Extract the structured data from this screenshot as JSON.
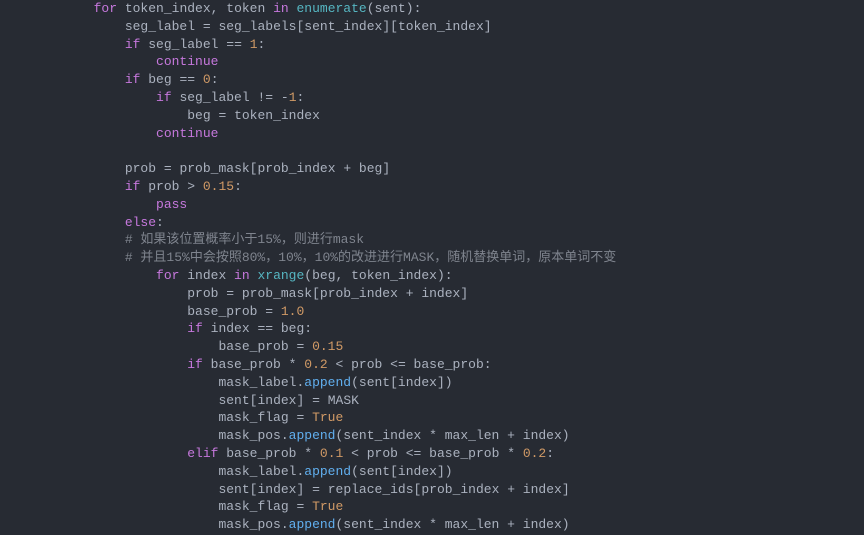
{
  "code": {
    "lines": [
      {
        "indent": 12,
        "parts": [
          [
            "kw",
            "for"
          ],
          [
            "",
            " token_index"
          ],
          [
            "op",
            ","
          ],
          [
            "",
            " token "
          ],
          [
            "kw",
            "in"
          ],
          [
            "",
            " "
          ],
          [
            "fn",
            "enumerate"
          ],
          [
            "op",
            "("
          ],
          [
            "",
            "sent"
          ],
          [
            "op",
            ")"
          ],
          [
            "op",
            ":"
          ]
        ]
      },
      {
        "indent": 16,
        "parts": [
          [
            "",
            "seg_label "
          ],
          [
            "op",
            "="
          ],
          [
            "",
            " seg_labels"
          ],
          [
            "op",
            "["
          ],
          [
            "",
            "sent_index"
          ],
          [
            "op",
            "]"
          ],
          [
            "op",
            "["
          ],
          [
            "",
            "token_index"
          ],
          [
            "op",
            "]"
          ]
        ]
      },
      {
        "indent": 16,
        "parts": [
          [
            "kw",
            "if"
          ],
          [
            "",
            " seg_label "
          ],
          [
            "op",
            "=="
          ],
          [
            "",
            " "
          ],
          [
            "num",
            "1"
          ],
          [
            "op",
            ":"
          ]
        ]
      },
      {
        "indent": 20,
        "parts": [
          [
            "kw",
            "continue"
          ]
        ]
      },
      {
        "indent": 16,
        "parts": [
          [
            "kw",
            "if"
          ],
          [
            "",
            " beg "
          ],
          [
            "op",
            "=="
          ],
          [
            "",
            " "
          ],
          [
            "num",
            "0"
          ],
          [
            "op",
            ":"
          ]
        ]
      },
      {
        "indent": 20,
        "parts": [
          [
            "kw",
            "if"
          ],
          [
            "",
            " seg_label "
          ],
          [
            "op",
            "!="
          ],
          [
            "",
            " "
          ],
          [
            "op",
            "-"
          ],
          [
            "num",
            "1"
          ],
          [
            "op",
            ":"
          ]
        ]
      },
      {
        "indent": 24,
        "parts": [
          [
            "",
            "beg "
          ],
          [
            "op",
            "="
          ],
          [
            "",
            " token_index"
          ]
        ]
      },
      {
        "indent": 20,
        "parts": [
          [
            "kw",
            "continue"
          ]
        ]
      },
      {
        "indent": 0,
        "parts": [
          [
            "",
            ""
          ]
        ]
      },
      {
        "indent": 16,
        "parts": [
          [
            "",
            "prob "
          ],
          [
            "op",
            "="
          ],
          [
            "",
            " prob_mask"
          ],
          [
            "op",
            "["
          ],
          [
            "",
            "prob_index "
          ],
          [
            "op",
            "+"
          ],
          [
            "",
            " beg"
          ],
          [
            "op",
            "]"
          ]
        ]
      },
      {
        "indent": 16,
        "parts": [
          [
            "kw",
            "if"
          ],
          [
            "",
            " prob "
          ],
          [
            "op",
            ">"
          ],
          [
            "",
            " "
          ],
          [
            "num",
            "0.15"
          ],
          [
            "op",
            ":"
          ]
        ]
      },
      {
        "indent": 20,
        "parts": [
          [
            "kw",
            "pass"
          ]
        ]
      },
      {
        "indent": 16,
        "parts": [
          [
            "kw",
            "else"
          ],
          [
            "op",
            ":"
          ]
        ]
      },
      {
        "indent": 16,
        "parts": [
          [
            "cmt",
            "# 如果该位置概率小于15%，则进行mask"
          ]
        ]
      },
      {
        "indent": 16,
        "parts": [
          [
            "cmt",
            "# 并且15%中会按照80%，10%，10%的改进进行MASK，随机替换单词，原本单词不变"
          ]
        ]
      },
      {
        "indent": 20,
        "parts": [
          [
            "kw",
            "for"
          ],
          [
            "",
            " index "
          ],
          [
            "kw",
            "in"
          ],
          [
            "",
            " "
          ],
          [
            "fn",
            "xrange"
          ],
          [
            "op",
            "("
          ],
          [
            "",
            "beg"
          ],
          [
            "op",
            ","
          ],
          [
            "",
            " token_index"
          ],
          [
            "op",
            ")"
          ],
          [
            "op",
            ":"
          ]
        ]
      },
      {
        "indent": 24,
        "parts": [
          [
            "",
            "prob "
          ],
          [
            "op",
            "="
          ],
          [
            "",
            " prob_mask"
          ],
          [
            "op",
            "["
          ],
          [
            "",
            "prob_index "
          ],
          [
            "op",
            "+"
          ],
          [
            "",
            " index"
          ],
          [
            "op",
            "]"
          ]
        ]
      },
      {
        "indent": 24,
        "parts": [
          [
            "",
            "base_prob "
          ],
          [
            "op",
            "="
          ],
          [
            "",
            " "
          ],
          [
            "num",
            "1.0"
          ]
        ]
      },
      {
        "indent": 24,
        "parts": [
          [
            "kw",
            "if"
          ],
          [
            "",
            " index "
          ],
          [
            "op",
            "=="
          ],
          [
            "",
            " beg"
          ],
          [
            "op",
            ":"
          ]
        ]
      },
      {
        "indent": 28,
        "parts": [
          [
            "",
            "base_prob "
          ],
          [
            "op",
            "="
          ],
          [
            "",
            " "
          ],
          [
            "num",
            "0.15"
          ]
        ]
      },
      {
        "indent": 24,
        "parts": [
          [
            "kw",
            "if"
          ],
          [
            "",
            " base_prob "
          ],
          [
            "op",
            "*"
          ],
          [
            "",
            " "
          ],
          [
            "num",
            "0.2"
          ],
          [
            "",
            " "
          ],
          [
            "op",
            "<"
          ],
          [
            "",
            " prob "
          ],
          [
            "op",
            "<="
          ],
          [
            "",
            " base_prob"
          ],
          [
            "op",
            ":"
          ]
        ]
      },
      {
        "indent": 28,
        "parts": [
          [
            "",
            "mask_label"
          ],
          [
            "op",
            "."
          ],
          [
            "call",
            "append"
          ],
          [
            "op",
            "("
          ],
          [
            "",
            "sent"
          ],
          [
            "op",
            "["
          ],
          [
            "",
            "index"
          ],
          [
            "op",
            "]"
          ],
          [
            "op",
            ")"
          ]
        ]
      },
      {
        "indent": 28,
        "parts": [
          [
            "",
            "sent"
          ],
          [
            "op",
            "["
          ],
          [
            "",
            "index"
          ],
          [
            "op",
            "]"
          ],
          [
            "",
            " "
          ],
          [
            "op",
            "="
          ],
          [
            "",
            " MASK"
          ]
        ]
      },
      {
        "indent": 28,
        "parts": [
          [
            "",
            "mask_flag "
          ],
          [
            "op",
            "="
          ],
          [
            "",
            " "
          ],
          [
            "bool",
            "True"
          ]
        ]
      },
      {
        "indent": 28,
        "parts": [
          [
            "",
            "mask_pos"
          ],
          [
            "op",
            "."
          ],
          [
            "call",
            "append"
          ],
          [
            "op",
            "("
          ],
          [
            "",
            "sent_index "
          ],
          [
            "op",
            "*"
          ],
          [
            "",
            " max_len "
          ],
          [
            "op",
            "+"
          ],
          [
            "",
            " index"
          ],
          [
            "op",
            ")"
          ]
        ]
      },
      {
        "indent": 24,
        "parts": [
          [
            "kw",
            "elif"
          ],
          [
            "",
            " base_prob "
          ],
          [
            "op",
            "*"
          ],
          [
            "",
            " "
          ],
          [
            "num",
            "0.1"
          ],
          [
            "",
            " "
          ],
          [
            "op",
            "<"
          ],
          [
            "",
            " prob "
          ],
          [
            "op",
            "<="
          ],
          [
            "",
            " base_prob "
          ],
          [
            "op",
            "*"
          ],
          [
            "",
            " "
          ],
          [
            "num",
            "0.2"
          ],
          [
            "op",
            ":"
          ]
        ]
      },
      {
        "indent": 28,
        "parts": [
          [
            "",
            "mask_label"
          ],
          [
            "op",
            "."
          ],
          [
            "call",
            "append"
          ],
          [
            "op",
            "("
          ],
          [
            "",
            "sent"
          ],
          [
            "op",
            "["
          ],
          [
            "",
            "index"
          ],
          [
            "op",
            "]"
          ],
          [
            "op",
            ")"
          ]
        ]
      },
      {
        "indent": 28,
        "parts": [
          [
            "",
            "sent"
          ],
          [
            "op",
            "["
          ],
          [
            "",
            "index"
          ],
          [
            "op",
            "]"
          ],
          [
            "",
            " "
          ],
          [
            "op",
            "="
          ],
          [
            "",
            " replace_ids"
          ],
          [
            "op",
            "["
          ],
          [
            "",
            "prob_index "
          ],
          [
            "op",
            "+"
          ],
          [
            "",
            " index"
          ],
          [
            "op",
            "]"
          ]
        ]
      },
      {
        "indent": 28,
        "parts": [
          [
            "",
            "mask_flag "
          ],
          [
            "op",
            "="
          ],
          [
            "",
            " "
          ],
          [
            "bool",
            "True"
          ]
        ]
      },
      {
        "indent": 28,
        "parts": [
          [
            "",
            "mask_pos"
          ],
          [
            "op",
            "."
          ],
          [
            "call",
            "append"
          ],
          [
            "op",
            "("
          ],
          [
            "",
            "sent_index "
          ],
          [
            "op",
            "*"
          ],
          [
            "",
            " max_len "
          ],
          [
            "op",
            "+"
          ],
          [
            "",
            " index"
          ],
          [
            "op",
            ")"
          ]
        ]
      }
    ]
  }
}
